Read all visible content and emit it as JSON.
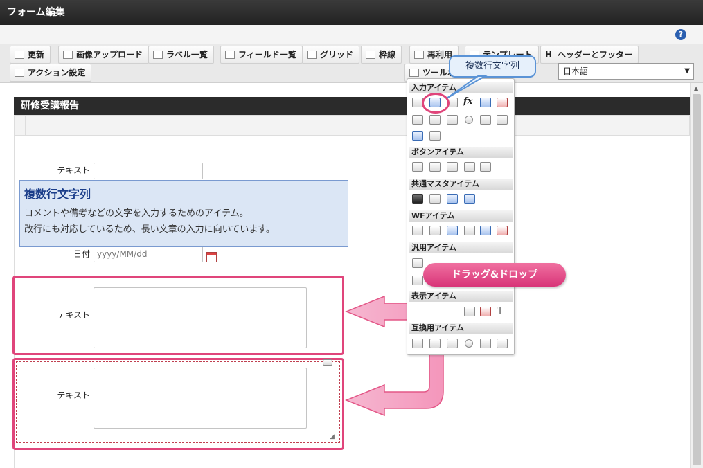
{
  "window": {
    "title": "フォーム編集"
  },
  "help": {
    "label": "?"
  },
  "toolbar": {
    "row1": [
      "更新",
      "画像アップロード",
      "ラベル一覧",
      "フィールド一覧",
      "グリッド",
      "枠線",
      "再利用",
      "テンプレート",
      "ヘッダーとフッター"
    ],
    "row2": [
      "アクション設定",
      "ツールボックス"
    ],
    "header_footer_prefix": "H"
  },
  "language": {
    "selected": "日本語",
    "arrow": "▼"
  },
  "form": {
    "title": "研修受講報告",
    "fields": [
      {
        "label": "テキスト",
        "value": ""
      },
      {
        "label": "日付",
        "placeholder": "yyyy/MM/dd"
      },
      {
        "label": "テキスト"
      },
      {
        "label": "テキスト"
      }
    ]
  },
  "info": {
    "title": "複数行文字列",
    "lines": [
      "コメントや備考などの文字を入力するためのアイテム。",
      "改行にも対応しているため、長い文章の入力に向いています。"
    ]
  },
  "palette": {
    "categories": [
      "入力アイテム",
      "ボタンアイテム",
      "共通マスタアイテム",
      "WFアイテム",
      "汎用アイテム",
      "表示アイテム",
      "互換用アイテム"
    ],
    "fx_label": "fx",
    "t_label": "T"
  },
  "callout": {
    "label": "複数行文字列"
  },
  "drag": {
    "label": "ドラッグ&ドロップ"
  },
  "colors": {
    "pink": "#e0457b",
    "header_dark": "#2b2b2b",
    "info_bg": "#dbe6f5"
  }
}
